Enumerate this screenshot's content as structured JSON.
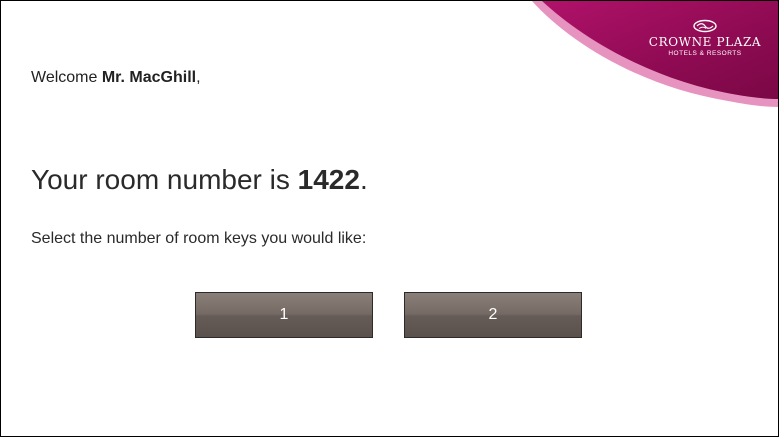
{
  "brand": {
    "name": "CROWNE PLAZA",
    "tagline": "HOTELS & RESORTS",
    "logo_icon": "crowne-plaza-logo-icon",
    "colors": {
      "primary": "#8a0a4e",
      "accent": "#c2185b"
    }
  },
  "welcome": {
    "greeting": "Welcome",
    "guest_name": "Mr. MacGhill",
    "punctuation": ","
  },
  "room": {
    "prefix": "Your room number is",
    "number": "1422",
    "suffix": "."
  },
  "keys": {
    "prompt": "Select the number of room keys you would like:",
    "options": [
      "1",
      "2"
    ],
    "button_color": "#746963"
  }
}
